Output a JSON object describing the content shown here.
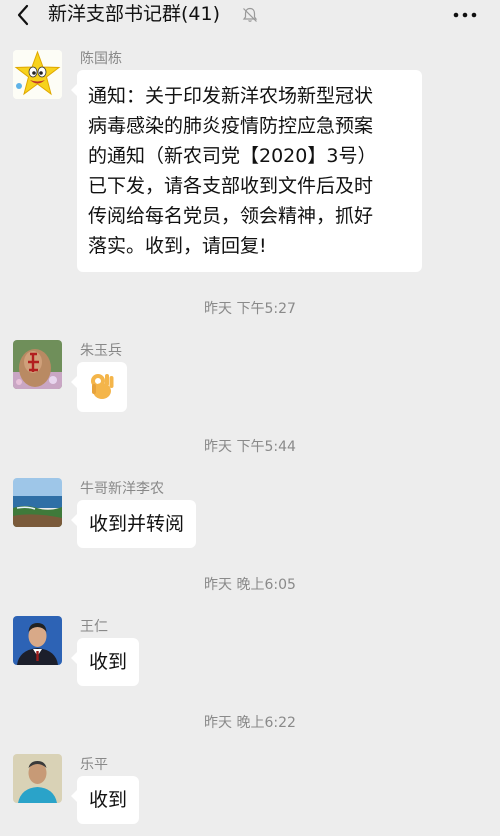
{
  "header": {
    "title": "新洋支部书记群(41)",
    "back_icon": "chevron-left-icon",
    "mute_icon": "bell-muted-icon",
    "more_icon": "more-dots-icon"
  },
  "messages": [
    {
      "sender": "陈国栋",
      "avatar": "star-face-avatar",
      "lines": [
        "通知：关于印发新洋农场新型冠状",
        "病毒感染的肺炎疫情防控应急预案",
        "的通知（新农司党【2020】3号）",
        "已下发，请各支部收到文件后及时",
        "传阅给每名党员，领会精神，抓好",
        "落实。收到，请回复!"
      ]
    },
    {
      "sender": "朱玉兵",
      "avatar": "rock-photo-avatar",
      "emoji": "ok-hand-emoji"
    },
    {
      "sender": "牛哥新洋李农",
      "avatar": "seaside-photo-avatar",
      "text": "收到并转阅"
    },
    {
      "sender": "王仁",
      "avatar": "man-in-suit-avatar",
      "text": "收到"
    },
    {
      "sender": "乐平",
      "avatar": "man-blue-shirt-avatar",
      "text": "收到"
    }
  ],
  "timestamps": [
    "昨天 下午5:27",
    "昨天 下午5:44",
    "昨天 晚上6:05",
    "昨天 晚上6:22"
  ]
}
